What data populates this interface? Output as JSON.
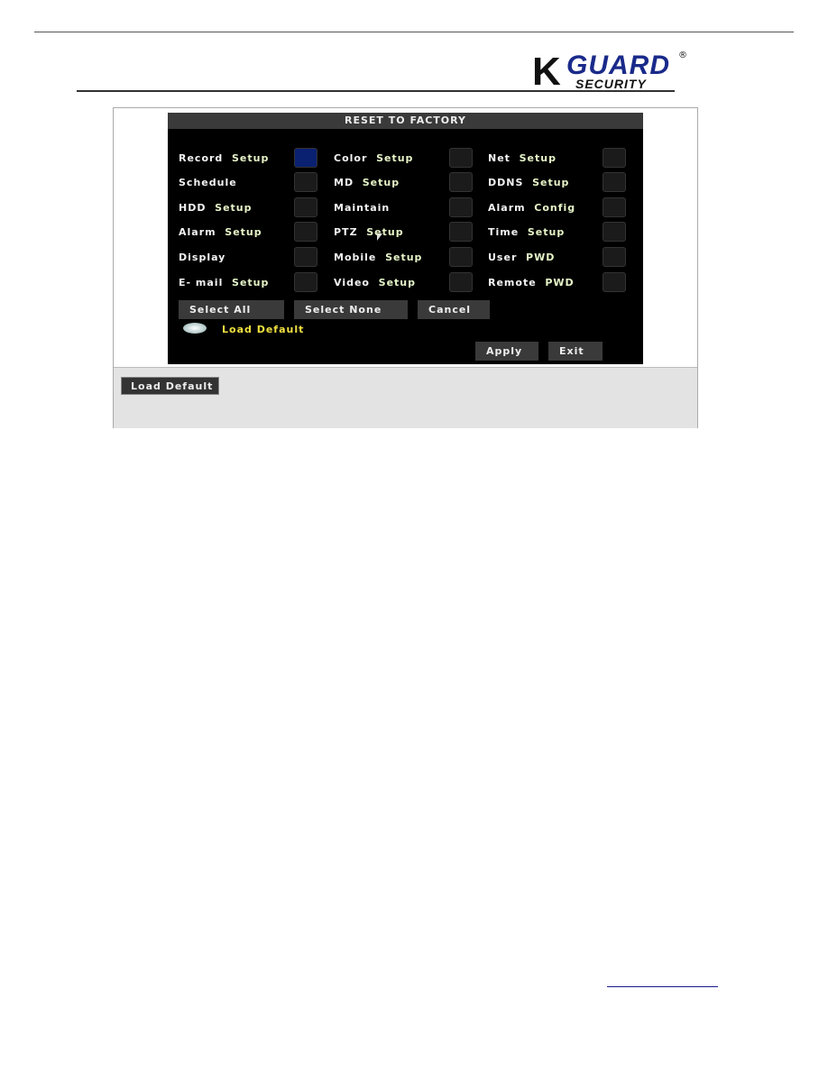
{
  "logo": {
    "brand": "KGUARD",
    "k": "K",
    "guard": "GUARD",
    "sub": "SECURITY",
    "reg": "®"
  },
  "dialog": {
    "title": "RESET TO FACTORY",
    "items": [
      {
        "label": "Record",
        "suffix": "Setup",
        "checked": true
      },
      {
        "label": "Color",
        "suffix": "Setup",
        "checked": false
      },
      {
        "label": "Net",
        "suffix": "Setup",
        "checked": false
      },
      {
        "label": "Schedule",
        "suffix": "",
        "checked": false
      },
      {
        "label": "MD",
        "suffix": "Setup",
        "checked": false
      },
      {
        "label": "DDNS",
        "suffix": "Setup",
        "checked": false
      },
      {
        "label": "HDD",
        "suffix": "Setup",
        "checked": false
      },
      {
        "label": "Maintain",
        "suffix": "",
        "checked": false
      },
      {
        "label": "Alarm",
        "suffix": "Config",
        "checked": false
      },
      {
        "label": "Alarm",
        "suffix": "Setup",
        "checked": false
      },
      {
        "label": "PTZ",
        "suffix": "Setup",
        "checked": false
      },
      {
        "label": "Time",
        "suffix": "Setup",
        "checked": false
      },
      {
        "label": "Display",
        "suffix": "",
        "checked": false
      },
      {
        "label": "Mobile",
        "suffix": "Setup",
        "checked": false
      },
      {
        "label": "User",
        "suffix": "PWD",
        "checked": false
      },
      {
        "label": "E- mail",
        "suffix": "Setup",
        "checked": false
      },
      {
        "label": "Video",
        "suffix": "Setup",
        "checked": false
      },
      {
        "label": "Remote",
        "suffix": "PWD",
        "checked": false
      }
    ],
    "select_all": "Select  All",
    "select_none": "Select  None",
    "cancel": "Cancel",
    "load_default": "Load  Default",
    "apply": "Apply",
    "exit": "Exit"
  },
  "panel": {
    "load_default_button": "Load Default"
  },
  "colors": {
    "selected_checkbox": "#0a2070",
    "load_default_text": "#f0e040",
    "logo_blue": "#1a2a8a"
  }
}
